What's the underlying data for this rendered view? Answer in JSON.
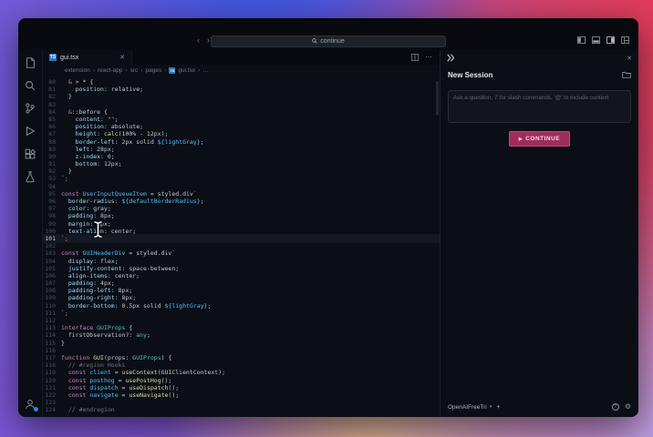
{
  "colors": {
    "accent_button": "#a02d59",
    "badge_blue": "#2f81f7",
    "ts_icon_blue": "#3178c6",
    "gradient_blue": "#2f56e8",
    "gradient_red": "#e23a57",
    "gradient_purple": "#7b55d4",
    "gradient_tan": "#e6c08c",
    "gradient_lavender": "#b9a3ea"
  },
  "titlebar": {
    "search_text": "continue",
    "back": "‹",
    "forward": "›"
  },
  "tab": {
    "label": "gui.tsx",
    "icon_text": "TS",
    "close": "✕"
  },
  "editor_actions": {
    "more": "⋯"
  },
  "breadcrumbs": [
    "extension",
    "react-app",
    "src",
    "pages",
    "gui.tsx",
    "…"
  ],
  "breadcrumb_sep": "›",
  "panel": {
    "title": "New Session",
    "close": "✕",
    "input_placeholder": "Ask a question, '/' for slash commands, '@' to include context",
    "continue_button": "CONTINUE",
    "play_icon": "▶",
    "model": {
      "label": "OpenAIFreeTri",
      "caret": "▾",
      "add": "+",
      "help": "?",
      "gear": "⚙"
    }
  },
  "editor": {
    "current_line": 101,
    "lines": [
      {
        "n": 80,
        "t": [
          [
            "  ",
            "pl"
          ],
          [
            "&",
            "kw"
          ],
          [
            " > * {",
            "pl"
          ]
        ]
      },
      {
        "n": 81,
        "t": [
          [
            "    position",
            "prop"
          ],
          [
            ": relative;",
            "pl"
          ]
        ]
      },
      {
        "n": 82,
        "t": [
          [
            "  }",
            "pl"
          ]
        ]
      },
      {
        "n": 83,
        "t": []
      },
      {
        "n": 84,
        "t": [
          [
            "  ",
            "pl"
          ],
          [
            "&",
            "kw"
          ],
          [
            "::before {",
            "pl"
          ]
        ]
      },
      {
        "n": 85,
        "t": [
          [
            "    content",
            "prop"
          ],
          [
            ": ",
            "pl"
          ],
          [
            "\"\"",
            "str"
          ],
          [
            ";",
            "pl"
          ]
        ]
      },
      {
        "n": 86,
        "t": [
          [
            "    position",
            "prop"
          ],
          [
            ": absolute;",
            "pl"
          ]
        ]
      },
      {
        "n": 87,
        "t": [
          [
            "    height",
            "prop"
          ],
          [
            ": ",
            "pl"
          ],
          [
            "calc",
            "fn"
          ],
          [
            "(100% - 12px);",
            "pl"
          ]
        ]
      },
      {
        "n": 88,
        "t": [
          [
            "    border-left",
            "prop"
          ],
          [
            ": 2px solid ",
            "pl"
          ],
          [
            "${lightGray}",
            "id"
          ],
          [
            ";",
            "pl"
          ]
        ]
      },
      {
        "n": 89,
        "t": [
          [
            "    left",
            "prop"
          ],
          [
            ": 28px;",
            "pl"
          ]
        ]
      },
      {
        "n": 90,
        "t": [
          [
            "    z-index",
            "prop"
          ],
          [
            ": 0;",
            "pl"
          ]
        ]
      },
      {
        "n": 91,
        "t": [
          [
            "    bottom",
            "prop"
          ],
          [
            ": 12px;",
            "pl"
          ]
        ]
      },
      {
        "n": 92,
        "t": [
          [
            "  }",
            "pl"
          ]
        ]
      },
      {
        "n": 93,
        "t": [
          [
            "`;",
            "str"
          ]
        ]
      },
      {
        "n": 94,
        "t": []
      },
      {
        "n": 95,
        "t": [
          [
            "const ",
            "kw"
          ],
          [
            "UserInputQueueItem",
            "id"
          ],
          [
            " = styled.div",
            "pl"
          ],
          [
            "`",
            "str"
          ]
        ]
      },
      {
        "n": 96,
        "t": [
          [
            "  border-radius",
            "prop"
          ],
          [
            ": ",
            "pl"
          ],
          [
            "${defaultBorderRadius}",
            "id"
          ],
          [
            ";",
            "pl"
          ]
        ]
      },
      {
        "n": 97,
        "t": [
          [
            "  color",
            "prop"
          ],
          [
            ": gray;",
            "pl"
          ]
        ]
      },
      {
        "n": 98,
        "t": [
          [
            "  padding",
            "prop"
          ],
          [
            ": 8px;",
            "pl"
          ]
        ]
      },
      {
        "n": 99,
        "t": [
          [
            "  margin",
            "prop"
          ],
          [
            ": 8px;",
            "pl"
          ]
        ]
      },
      {
        "n": 100,
        "t": [
          [
            "  text-align",
            "prop"
          ],
          [
            ": center;",
            "pl"
          ]
        ]
      },
      {
        "n": 101,
        "t": [
          [
            "`;",
            "str"
          ]
        ]
      },
      {
        "n": 102,
        "t": []
      },
      {
        "n": 103,
        "t": [
          [
            "const ",
            "kw"
          ],
          [
            "GUIHeaderDiv",
            "id"
          ],
          [
            " = styled.div",
            "pl"
          ],
          [
            "`",
            "str"
          ]
        ]
      },
      {
        "n": 104,
        "t": [
          [
            "  display",
            "prop"
          ],
          [
            ": flex;",
            "pl"
          ]
        ]
      },
      {
        "n": 105,
        "t": [
          [
            "  justify-content",
            "prop"
          ],
          [
            ": space-between;",
            "pl"
          ]
        ]
      },
      {
        "n": 106,
        "t": [
          [
            "  align-items",
            "prop"
          ],
          [
            ": center;",
            "pl"
          ]
        ]
      },
      {
        "n": 107,
        "t": [
          [
            "  padding",
            "prop"
          ],
          [
            ": 4px;",
            "pl"
          ]
        ]
      },
      {
        "n": 108,
        "t": [
          [
            "  padding-left",
            "prop"
          ],
          [
            ": 8px;",
            "pl"
          ]
        ]
      },
      {
        "n": 109,
        "t": [
          [
            "  padding-right",
            "prop"
          ],
          [
            ": 8px;",
            "pl"
          ]
        ]
      },
      {
        "n": 110,
        "t": [
          [
            "  border-bottom",
            "prop"
          ],
          [
            ": 0.5px solid ",
            "pl"
          ],
          [
            "${lightGray}",
            "id"
          ],
          [
            ";",
            "pl"
          ]
        ]
      },
      {
        "n": 111,
        "t": [
          [
            "`;",
            "str"
          ]
        ]
      },
      {
        "n": 112,
        "t": []
      },
      {
        "n": 113,
        "t": [
          [
            "interface ",
            "kw"
          ],
          [
            "GUIProps",
            "ty"
          ],
          [
            " {",
            "pl"
          ]
        ]
      },
      {
        "n": 114,
        "t": [
          [
            "  firstObservation?: ",
            "pl"
          ],
          [
            "any",
            "ty"
          ],
          [
            ";",
            "pl"
          ]
        ]
      },
      {
        "n": 115,
        "t": [
          [
            "}",
            "pl"
          ]
        ]
      },
      {
        "n": 116,
        "t": []
      },
      {
        "n": 117,
        "t": [
          [
            "function ",
            "kw"
          ],
          [
            "GUI",
            "fn"
          ],
          [
            "(props: ",
            "pl"
          ],
          [
            "GUIProps",
            "ty"
          ],
          [
            ") {",
            "pl"
          ]
        ]
      },
      {
        "n": 118,
        "t": [
          [
            "  // #region Hooks",
            "cm"
          ]
        ]
      },
      {
        "n": 119,
        "t": [
          [
            "  const ",
            "kw"
          ],
          [
            "client",
            "id"
          ],
          [
            " = ",
            "pl"
          ],
          [
            "useContext",
            "fn"
          ],
          [
            "(GUIClientContext);",
            "pl"
          ]
        ]
      },
      {
        "n": 120,
        "t": [
          [
            "  const ",
            "kw"
          ],
          [
            "posthog",
            "id"
          ],
          [
            " = ",
            "pl"
          ],
          [
            "usePostHog",
            "fn"
          ],
          [
            "();",
            "pl"
          ]
        ]
      },
      {
        "n": 121,
        "t": [
          [
            "  const ",
            "kw"
          ],
          [
            "dispatch",
            "id"
          ],
          [
            " = ",
            "pl"
          ],
          [
            "useDispatch",
            "fn"
          ],
          [
            "();",
            "pl"
          ]
        ]
      },
      {
        "n": 122,
        "t": [
          [
            "  const ",
            "kw"
          ],
          [
            "navigate",
            "id"
          ],
          [
            " = ",
            "pl"
          ],
          [
            "useNavigate",
            "fn"
          ],
          [
            "();",
            "pl"
          ]
        ]
      },
      {
        "n": 123,
        "t": []
      },
      {
        "n": 124,
        "t": [
          [
            "  // #endregion",
            "cm"
          ]
        ]
      }
    ]
  }
}
